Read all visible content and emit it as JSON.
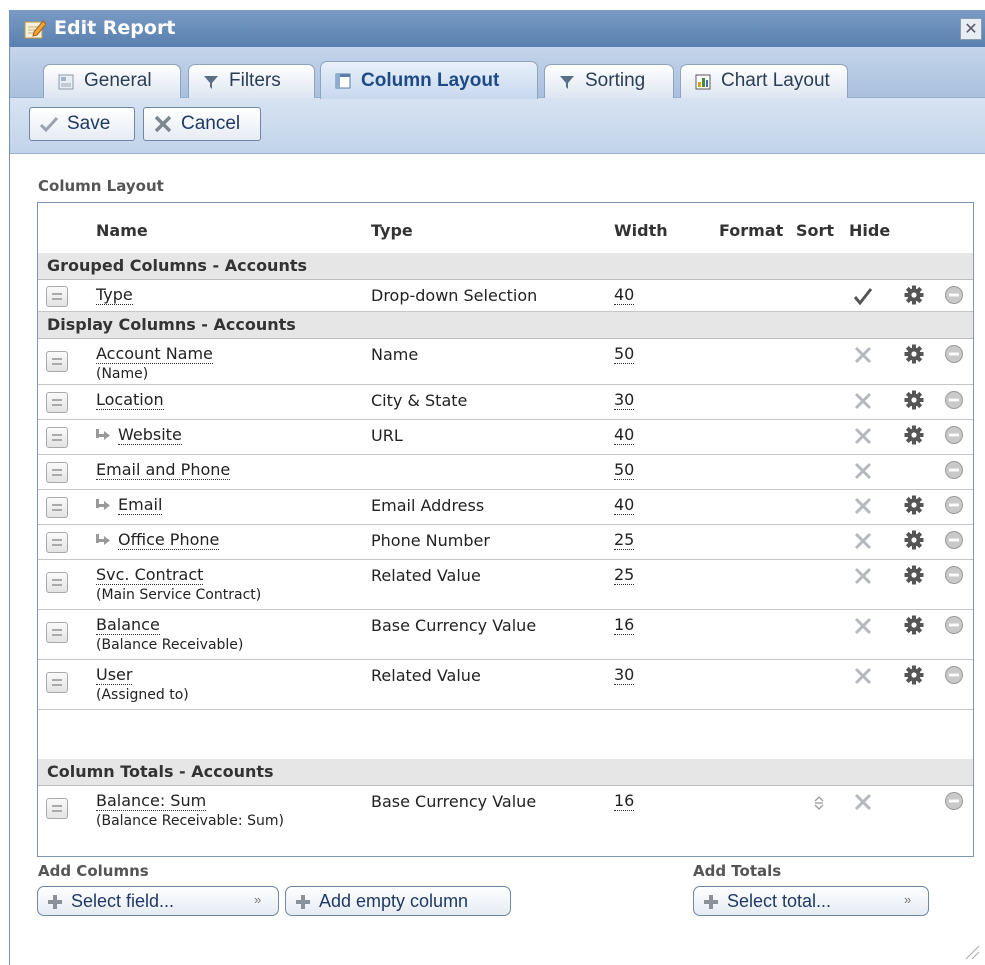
{
  "window": {
    "title": "Edit Report",
    "close_glyph": "✕"
  },
  "tabs": [
    {
      "label": "General",
      "icon": "general-tab-icon",
      "active": false
    },
    {
      "label": "Filters",
      "icon": "filter-icon",
      "active": false
    },
    {
      "label": "Column Layout",
      "icon": "column-layout-icon",
      "active": true
    },
    {
      "label": "Sorting",
      "icon": "sort-filter-icon",
      "active": false
    },
    {
      "label": "Chart Layout",
      "icon": "chart-icon",
      "active": false
    }
  ],
  "toolbar": {
    "save_label": "Save",
    "cancel_label": "Cancel"
  },
  "section_title": "Column Layout",
  "headers": {
    "name": "Name",
    "type": "Type",
    "width": "Width",
    "format": "Format",
    "sort": "Sort",
    "hide": "Hide"
  },
  "groups": {
    "grouped": "Grouped Columns - Accounts",
    "display": "Display Columns - Accounts",
    "totals": "Column Totals - Accounts"
  },
  "rows": [
    {
      "name": "Type",
      "sub": "",
      "type": "Drop-down Selection",
      "width": "40",
      "hidden": true,
      "indent": false
    },
    {
      "name": "Account Name",
      "sub": "(Name)",
      "type": "Name",
      "width": "50",
      "hidden": false,
      "indent": false
    },
    {
      "name": "Location",
      "sub": "",
      "type": "City & State",
      "width": "30",
      "hidden": false,
      "indent": false
    },
    {
      "name": "Website",
      "sub": "",
      "type": "URL",
      "width": "40",
      "hidden": false,
      "indent": true
    },
    {
      "name": "Email and Phone",
      "sub": "",
      "type": "",
      "width": "50",
      "hidden": false,
      "indent": false
    },
    {
      "name": "Email",
      "sub": "",
      "type": "Email Address",
      "width": "40",
      "hidden": false,
      "indent": true
    },
    {
      "name": "Office Phone",
      "sub": "",
      "type": "Phone Number",
      "width": "25",
      "hidden": false,
      "indent": true
    },
    {
      "name": "Svc. Contract",
      "sub": "(Main Service Contract)",
      "type": "Related Value",
      "width": "25",
      "hidden": false,
      "indent": false
    },
    {
      "name": "Balance",
      "sub": "(Balance Receivable)",
      "type": "Base Currency Value",
      "width": "16",
      "hidden": false,
      "indent": false
    },
    {
      "name": "User",
      "sub": "(Assigned to)",
      "type": "Related Value",
      "width": "30",
      "hidden": false,
      "indent": false
    },
    {
      "name": "Balance: Sum",
      "sub": "(Balance Receivable: Sum)",
      "type": "Base Currency Value",
      "width": "16",
      "hidden": false,
      "indent": false
    }
  ],
  "add_columns": {
    "label": "Add Columns",
    "select_field": "Select field...",
    "add_empty": "Add empty column"
  },
  "add_totals": {
    "label": "Add Totals",
    "select_total": "Select total..."
  },
  "colors": {
    "titlebar": "#5a7fae",
    "tab_active_text": "#1f4a86",
    "grid_border": "#7d96b6",
    "group_bg": "#e6e6e6"
  }
}
